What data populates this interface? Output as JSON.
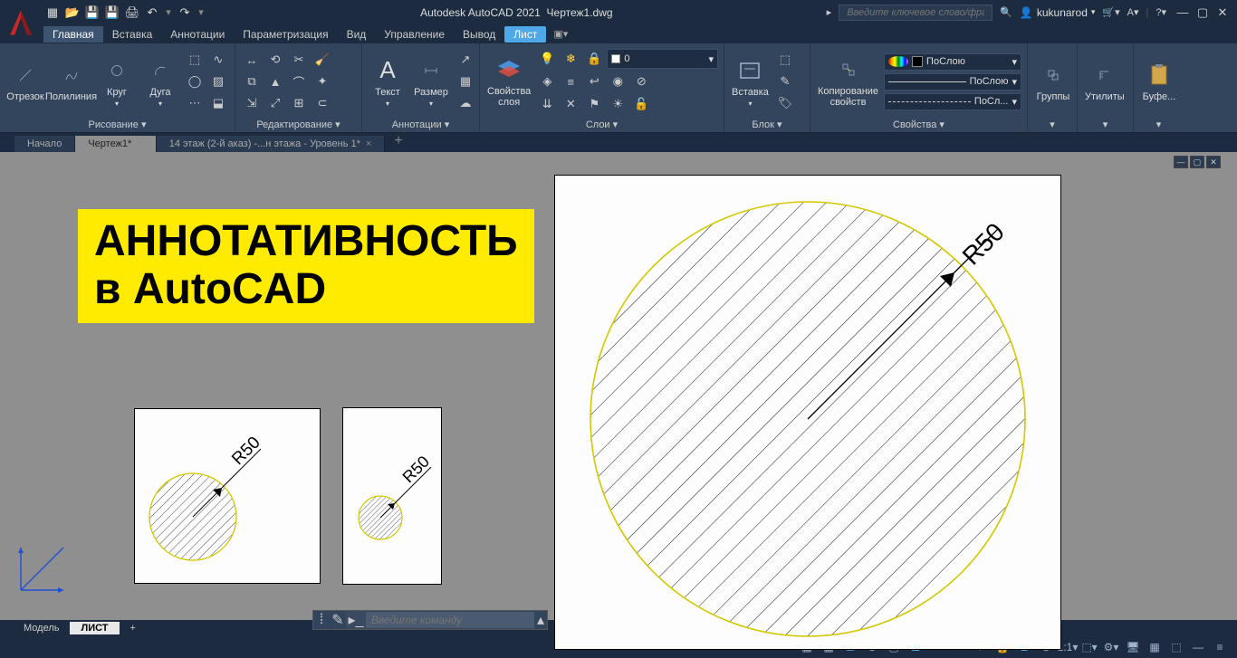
{
  "title": {
    "app": "Autodesk AutoCAD 2021",
    "file": "Чертеж1.dwg"
  },
  "search_placeholder": "Введите ключевое слово/фразу",
  "user": "kukunarod",
  "menu": {
    "tabs": [
      "Главная",
      "Вставка",
      "Аннотации",
      "Параметризация",
      "Вид",
      "Управление",
      "Вывод",
      "Лист"
    ]
  },
  "ribbon": {
    "draw": {
      "label": "Рисование ▾",
      "line": "Отрезок",
      "polyline": "Полилиния",
      "circle": "Круг",
      "arc": "Дуга"
    },
    "edit": {
      "label": "Редактирование ▾"
    },
    "anno": {
      "label": "Аннотации ▾",
      "text": "Текст",
      "dim": "Размер"
    },
    "layer": {
      "label": "Слои ▾",
      "props": "Свойства\nслоя",
      "current": "0"
    },
    "block": {
      "label": "Блок ▾",
      "insert": "Вставка"
    },
    "props": {
      "label": "Свойства ▾",
      "match": "Копирование\nсвойств",
      "bylayer": "ПоСлою",
      "byblock": "ПоСлою",
      "lt": "ПоСл..."
    },
    "groups": {
      "label": "▾",
      "btn": "Группы"
    },
    "utils": {
      "label": "▾",
      "btn": "Утилиты"
    },
    "clip": {
      "label": "▾",
      "btn": "Буфе..."
    }
  },
  "file_tabs": {
    "start": "Начало",
    "f1": "Чертеж1*",
    "f2": "14 этаж (2-й аказ) -...н этажа - Уровень 1*"
  },
  "overlay": {
    "l1": "АННОТАТИВНОСТЬ",
    "l2": "в AutoCAD"
  },
  "dims": {
    "r1": "R50",
    "r2": "R50",
    "r3": "R50"
  },
  "cmd_placeholder": "Введите команду",
  "layouts": {
    "model": "Модель",
    "sheet": "ЛИСТ"
  }
}
